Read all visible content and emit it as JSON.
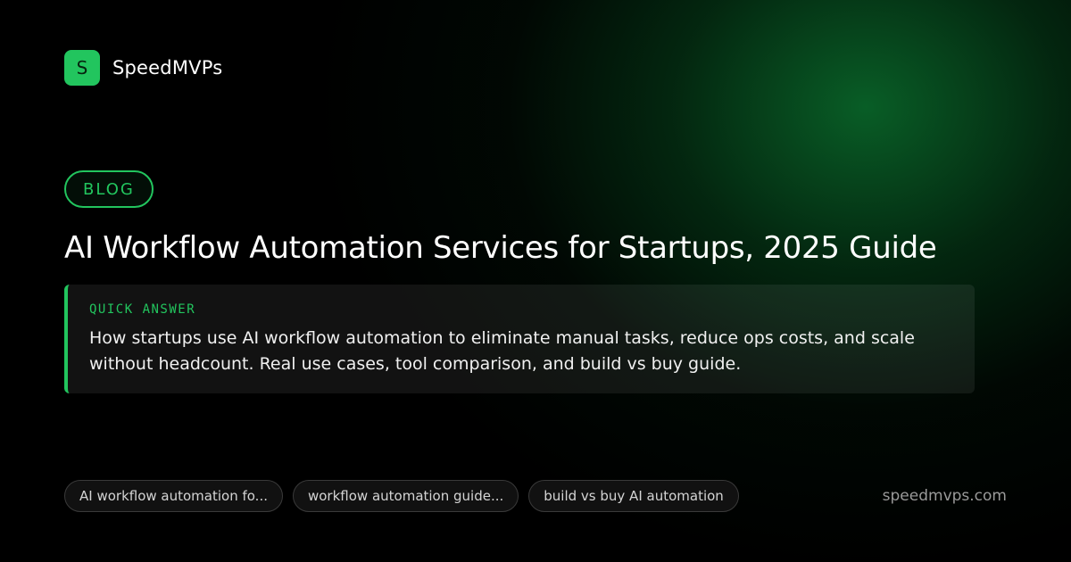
{
  "brand": {
    "logo_letter": "S",
    "name": "SpeedMVPs",
    "accent_color": "#22c55e"
  },
  "category": "BLOG",
  "title": "AI Workflow Automation Services for Startups, 2025 Guide",
  "quick_answer": {
    "label": "QUICK ANSWER",
    "text": "How startups use AI workflow automation to eliminate manual tasks, reduce ops costs, and scale without headcount. Real use cases, tool comparison, and build vs buy guide."
  },
  "tags": [
    "AI workflow automation fo...",
    "workflow automation guide...",
    "build vs buy AI automation"
  ],
  "domain": "speedmvps.com"
}
